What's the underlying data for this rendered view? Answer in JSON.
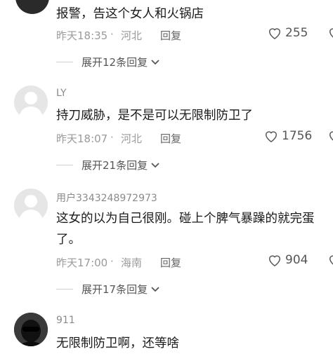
{
  "comments": [
    {
      "text": "报警，告这个女人和火锅店",
      "time": "昨天18:35",
      "location": "河北",
      "reply_label": "回复",
      "likes": "255",
      "expand": "展开12条回复"
    },
    {
      "username": "LY",
      "text": "持刀威胁，是不是可以无限制防卫了",
      "time": "昨天18:07",
      "location": "河北",
      "reply_label": "回复",
      "likes": "1756",
      "expand": "展开21条回复"
    },
    {
      "username": "用户3343248972973",
      "text_line1": "这女的以为自己很刚。碰上个脾气暴躁的就完蛋",
      "text_line2": "了。",
      "time": "昨天17:00",
      "location": "海南",
      "reply_label": "回复",
      "likes": "904",
      "expand": "展开17条回复"
    },
    {
      "username": "911",
      "text": "无限制防卫啊，还等啥"
    }
  ],
  "separator": "·",
  "icons": {
    "like": "heart-outline-icon",
    "expand": "chevron-down-icon",
    "avatar_default": "default-avatar-icon"
  }
}
